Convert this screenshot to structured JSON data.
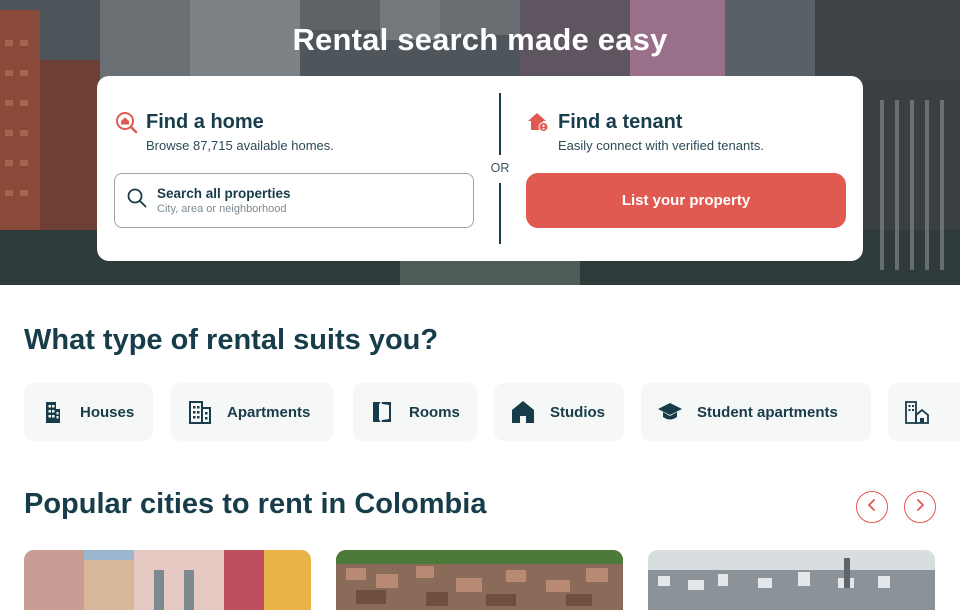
{
  "hero": {
    "title": "Rental search made easy"
  },
  "find_home": {
    "title": "Find a home",
    "subtitle": "Browse 87,715 available homes.",
    "icon": "home-search-icon"
  },
  "search": {
    "label": "Search all properties",
    "placeholder": "City, area or neighborhood"
  },
  "divider": {
    "or_label": "OR"
  },
  "find_tenant": {
    "title": "Find a tenant",
    "subtitle": "Easily connect with verified tenants.",
    "icon": "house-user-icon",
    "button_label": "List your property"
  },
  "rental_types": {
    "title": "What type of rental suits you?",
    "items": [
      {
        "label": "Houses",
        "icon": "building-tall-icon"
      },
      {
        "label": "Apartments",
        "icon": "apartment-building-icon"
      },
      {
        "label": "Rooms",
        "icon": "door-open-icon"
      },
      {
        "label": "Studios",
        "icon": "house-icon"
      },
      {
        "label": "Student apartments",
        "icon": "graduation-cap-icon"
      },
      {
        "label": "",
        "icon": "building-house-icon"
      }
    ]
  },
  "cities": {
    "title": "Popular cities to rent in Colombia",
    "prev_icon": "chevron-left-icon",
    "next_icon": "chevron-right-icon"
  },
  "colors": {
    "primary": "#173c4a",
    "accent": "#e05a52",
    "chip_bg": "#f6f7f7"
  }
}
